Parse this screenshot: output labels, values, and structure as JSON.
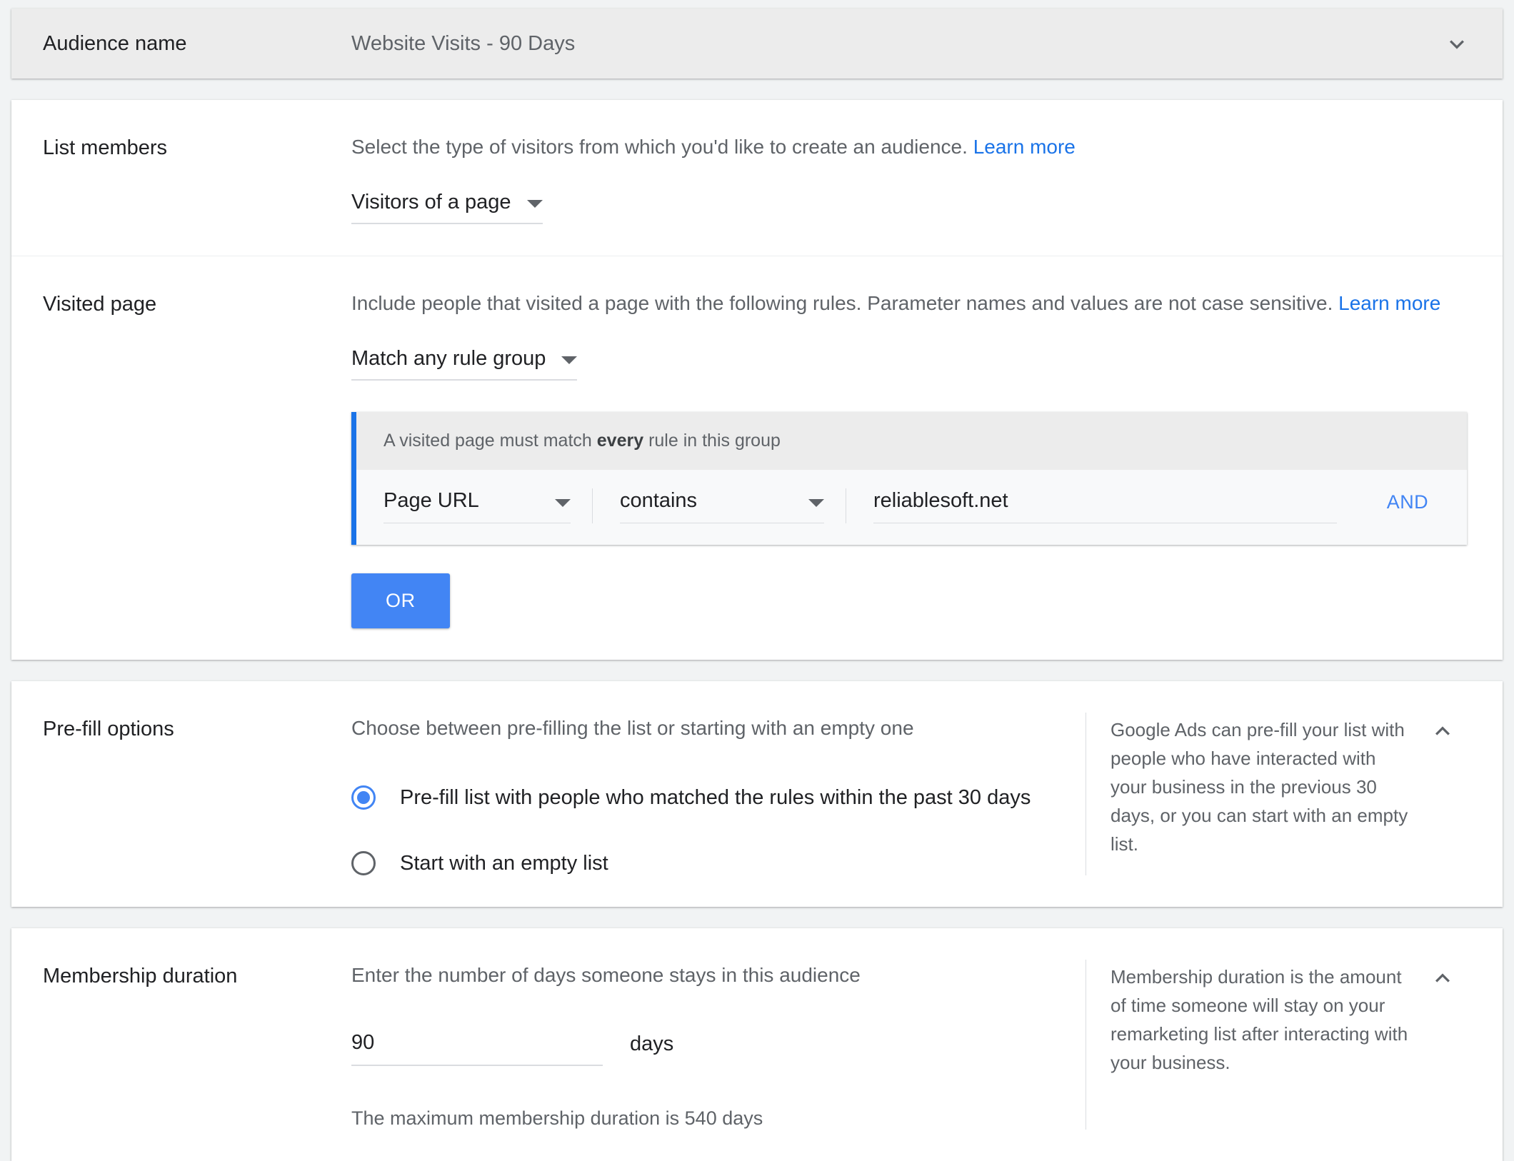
{
  "audience_name": {
    "label": "Audience name",
    "value": "Website Visits - 90 Days",
    "expand_icon": "chevron-down-icon"
  },
  "list_members": {
    "label": "List members",
    "description": "Select the type of visitors from which you'd like to create an audience.",
    "learn_more": "Learn more",
    "selected_type": "Visitors of a page"
  },
  "visited_page": {
    "label": "Visited page",
    "description": "Include people that visited a page with the following rules. Parameter names and values are not case sensitive.",
    "learn_more": "Learn more",
    "match_mode": "Match any rule group",
    "rule_group": {
      "header_prefix": "A visited page must match ",
      "header_bold": "every",
      "header_suffix": " rule in this group",
      "dimension": "Page URL",
      "operator": "contains",
      "value": "reliablesoft.net",
      "and_label": "AND",
      "accent_color": "#1A73E8"
    },
    "or_button": "OR"
  },
  "prefill": {
    "label": "Pre-fill options",
    "description": "Choose between pre-filling the list or starting with an empty one",
    "options": [
      {
        "label": "Pre-fill list with people who matched the rules within the past 30 days",
        "selected": true
      },
      {
        "label": "Start with an empty list",
        "selected": false
      }
    ],
    "help": "Google Ads can pre-fill your list with people who have interacted with your business in the previous 30 days, or you can start with an empty list.",
    "collapse_icon": "chevron-up-icon"
  },
  "membership": {
    "label": "Membership duration",
    "description": "Enter the number of days someone stays in this audience",
    "value": "90",
    "placeholder": "",
    "unit": "days",
    "max_note": "The maximum membership duration is 540 days",
    "help": "Membership duration is the amount of time someone will stay on your remarketing list after interacting with your business.",
    "collapse_icon": "chevron-up-icon"
  },
  "colors": {
    "accent_blue": "#4285F4",
    "link_blue": "#1A73E8",
    "page_bg": "#F1F3F4"
  }
}
